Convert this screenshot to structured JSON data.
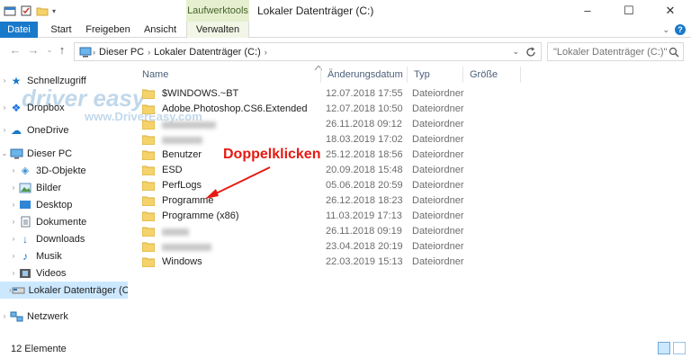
{
  "window": {
    "title": "Lokaler Datenträger (C:)",
    "tool_tab_title": "Laufwerktools",
    "controls": {
      "minimize": "–",
      "maximize": "☐",
      "close": "✕"
    }
  },
  "ribbon": {
    "tabs": [
      "Datei",
      "Start",
      "Freigeben",
      "Ansicht",
      "Verwalten"
    ],
    "expand_icon": "chevron-down-icon",
    "help_icon": "help-icon"
  },
  "address": {
    "crumbs": [
      "Dieser PC",
      "Lokaler Datenträger (C:)"
    ]
  },
  "search": {
    "placeholder": "\"Lokaler Datenträger (C:)\" durc..."
  },
  "nav": {
    "items": [
      {
        "label": "Schnellzugriff",
        "icon": "star-icon"
      },
      {
        "label": "Dropbox",
        "icon": "dropbox-icon"
      },
      {
        "label": "OneDrive",
        "icon": "cloud-icon"
      },
      {
        "label": "Dieser PC",
        "icon": "computer-icon"
      },
      {
        "label": "3D-Objekte",
        "icon": "cube-icon"
      },
      {
        "label": "Bilder",
        "icon": "pictures-icon"
      },
      {
        "label": "Desktop",
        "icon": "desktop-icon"
      },
      {
        "label": "Dokumente",
        "icon": "documents-icon"
      },
      {
        "label": "Downloads",
        "icon": "download-icon"
      },
      {
        "label": "Musik",
        "icon": "music-icon"
      },
      {
        "label": "Videos",
        "icon": "video-icon"
      },
      {
        "label": "Lokaler Datenträger (C:)",
        "icon": "drive-icon"
      },
      {
        "label": "Netzwerk",
        "icon": "network-icon"
      }
    ]
  },
  "columns": [
    "Name",
    "Änderungsdatum",
    "Typ",
    "Größe"
  ],
  "files": [
    {
      "name": "$WINDOWS.~BT",
      "date": "12.07.2018 17:55",
      "type": "Dateiordner"
    },
    {
      "name": "Adobe.Photoshop.CS6.Extended",
      "date": "12.07.2018 10:50",
      "type": "Dateiordner"
    },
    {
      "name": "",
      "date": "26.11.2018 09:12",
      "type": "Dateiordner"
    },
    {
      "name": "",
      "date": "18.03.2019 17:02",
      "type": "Dateiordner"
    },
    {
      "name": "Benutzer",
      "date": "25.12.2018 18:56",
      "type": "Dateiordner"
    },
    {
      "name": "ESD",
      "date": "20.09.2018 15:48",
      "type": "Dateiordner"
    },
    {
      "name": "PerfLogs",
      "date": "05.06.2018 20:59",
      "type": "Dateiordner"
    },
    {
      "name": "Programme",
      "date": "26.12.2018 18:23",
      "type": "Dateiordner"
    },
    {
      "name": "Programme (x86)",
      "date": "11.03.2019 17:13",
      "type": "Dateiordner"
    },
    {
      "name": "",
      "date": "26.11.2018 09:19",
      "type": "Dateiordner"
    },
    {
      "name": "",
      "date": "23.04.2018 20:19",
      "type": "Dateiordner"
    },
    {
      "name": "Windows",
      "date": "22.03.2019 15:13",
      "type": "Dateiordner"
    }
  ],
  "annotation": "Doppelklicken",
  "watermark": {
    "logo": "driver easy",
    "url": "www.DriverEasy.com"
  },
  "status": {
    "count": "12 Elemente"
  }
}
